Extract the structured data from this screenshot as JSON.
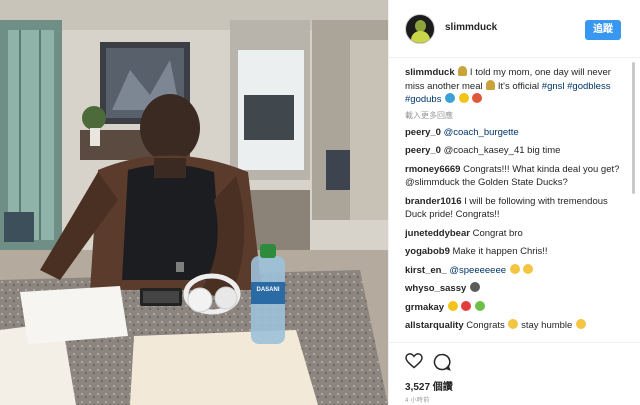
{
  "post": {
    "username": "slimmduck",
    "follow_label": "追蹤",
    "caption": {
      "user": "slimmduck",
      "text_1": "I told my mom, one day will never miss another meal",
      "text_2": "It's official",
      "hashtags": "#gnsl #godbless #godubs"
    },
    "load_more_label": "載入更多回應",
    "comments": [
      {
        "user": "peery_0",
        "text": "@coach_burgette"
      },
      {
        "user": "peery_0",
        "text": "@coach_kasey_41 big time"
      },
      {
        "user": "rmoney6669",
        "text": "Congrats!!! What kinda deal you get? @slimmduck the Golden State Ducks?"
      },
      {
        "user": "brander1016",
        "text": "I will be following with tremendous Duck pride! Congrats!!"
      },
      {
        "user": "juneteddybear",
        "text": "Congrat bro"
      },
      {
        "user": "yogabob9",
        "text": "Make it happen Chris!!"
      },
      {
        "user": "kirst_en_",
        "text": "@speeeeeee"
      },
      {
        "user": "whyso_sassy",
        "text": ""
      },
      {
        "user": "grmakay",
        "text": ""
      },
      {
        "user": "allstarquality",
        "text_1": "Congrats",
        "text_2": "stay humble"
      }
    ],
    "likes": "3,527 個讚",
    "time_ago": "4 小時前"
  },
  "photo": {
    "bottle_brand": "DASANI"
  },
  "icons": {
    "like": "heart-outline-icon",
    "comment": "speech-bubble-icon"
  },
  "colors": {
    "follow_button": "#3897f0",
    "hashtag": "#003569",
    "meta_text": "#999999"
  }
}
